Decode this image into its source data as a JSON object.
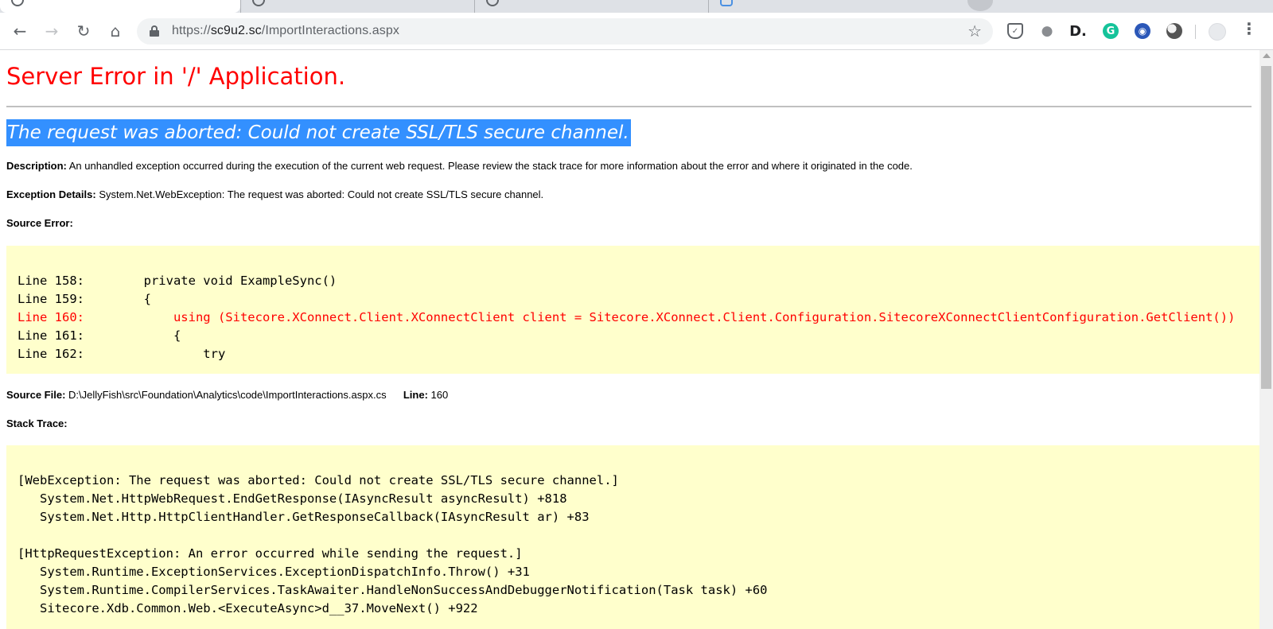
{
  "browser": {
    "address_bar": {
      "url_scheme": "https://",
      "url_host": "sc9u2.sc",
      "url_path": "/ImportInteractions.aspx"
    }
  },
  "page": {
    "title": "Server Error in '/' Application.",
    "error_heading": "The request was aborted: Could not create SSL/TLS secure channel.",
    "description": {
      "label": "Description:",
      "text": "An unhandled exception occurred during the execution of the current web request. Please review the stack trace for more information about the error and where it originated in the code."
    },
    "exception_details": {
      "label": "Exception Details:",
      "text": "System.Net.WebException: The request was aborted: Could not create SSL/TLS secure channel."
    },
    "source_error_label": "Source Error:",
    "source_code_lines": [
      "Line 158:        private void ExampleSync()",
      "Line 159:        {",
      "Line 160:            using (Sitecore.XConnect.Client.XConnectClient client = Sitecore.XConnect.Client.Configuration.SitecoreXConnectClientConfiguration.GetClient())",
      "Line 161:            {",
      "Line 162:                try"
    ],
    "source_file": {
      "label": "Source File:",
      "path": "D:\\JellyFish\\src\\Foundation\\Analytics\\code\\ImportInteractions.aspx.cs",
      "line_label": "Line:",
      "line_number": "160"
    },
    "stack_trace_label": "Stack Trace:",
    "stack_trace_lines": [
      "[WebException: The request was aborted: Could not create SSL/TLS secure channel.]",
      "   System.Net.HttpWebRequest.EndGetResponse(IAsyncResult asyncResult) +818",
      "   System.Net.Http.HttpClientHandler.GetResponseCallback(IAsyncResult ar) +83",
      "",
      "[HttpRequestException: An error occurred while sending the request.]",
      "   System.Runtime.ExceptionServices.ExceptionDispatchInfo.Throw() +31",
      "   System.Runtime.CompilerServices.TaskAwaiter.HandleNonSuccessAndDebuggerNotification(Task task) +60",
      "   Sitecore.Xdb.Common.Web.<ExecuteAsync>d__37.MoveNext() +922"
    ]
  },
  "colors": {
    "error_title": "#ff0000",
    "selection_highlight": "#3390ff",
    "code_background": "#ffffcc",
    "error_line": "#ff0000"
  },
  "icons": {
    "back": "arrow-left",
    "forward": "arrow-right",
    "reload": "circular-arrow",
    "home": "house",
    "secure": "lock",
    "bookmark": "star",
    "menu": "three-dots-vertical"
  }
}
